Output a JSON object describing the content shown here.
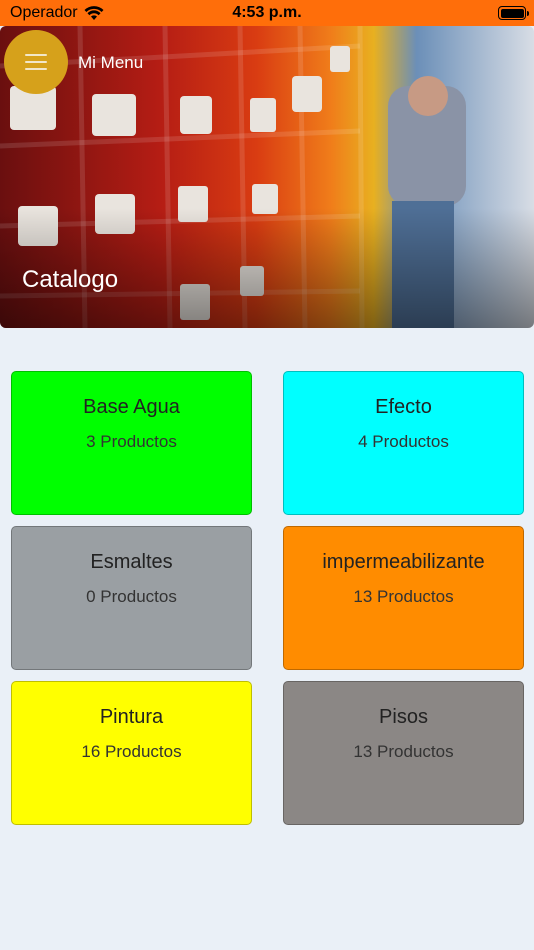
{
  "status_bar": {
    "carrier": "Operador",
    "time": "4:53 p.m.",
    "battery_level": 1.0
  },
  "nav": {
    "menu_label": "Mi Menu",
    "menu_icon": "hamburger-icon"
  },
  "hero": {
    "title": "Catalogo"
  },
  "categories": [
    {
      "name": "Base Agua",
      "count": "3 Productos",
      "color": "#00ff00"
    },
    {
      "name": "Efecto",
      "count": "4 Productos",
      "color": "#00ffff"
    },
    {
      "name": "Esmaltes",
      "count": "0 Productos",
      "color": "#9a9fa3"
    },
    {
      "name": "impermeabilizante",
      "count": "13 Productos",
      "color": "#ff8c00"
    },
    {
      "name": "Pintura",
      "count": "16 Productos",
      "color": "#ffff00"
    },
    {
      "name": "Pisos",
      "count": "13 Productos",
      "color": "#8b8785"
    }
  ]
}
